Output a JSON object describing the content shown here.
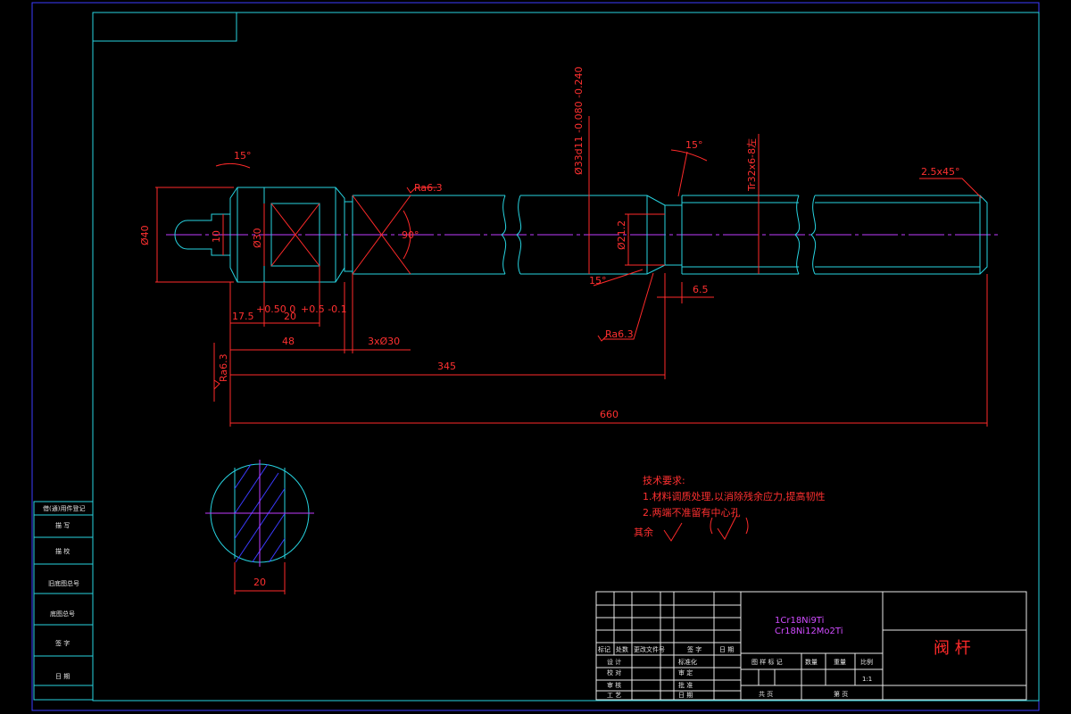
{
  "part_view": {
    "dims": {
      "d40": "Ø40",
      "d10": "10",
      "d30": "Ø30",
      "ang15_left": "15°",
      "ang90": "90°",
      "ang15_mid": "15°",
      "ang15_low": "15°",
      "d212": "Ø21.2",
      "d33": "Ø33d11 -0.080 -0.240",
      "thread": "Tr32x6-8左",
      "chamfer": "2.5x45°",
      "ra_top": "Ra6.3",
      "ra_low": "Ra6.3",
      "ra_left": "Ra6.3",
      "len175": "17.5",
      "tol175": "+0.50 0",
      "len20": "20",
      "tol20": "+0.5 -0.1",
      "len48": "48",
      "grooves": "3xØ30",
      "len65": "6.5",
      "len345": "345",
      "len660": "660"
    },
    "section_dim": "20"
  },
  "notes": {
    "title": "技术要求:",
    "line1": "1.材料调质处理,以消除残余应力,提高韧性",
    "line2": "2.两端不准留有中心孔",
    "rest_label": "其余"
  },
  "left_strip": {
    "items": [
      "借(通)用件登记",
      "描 写",
      "描 校",
      "旧底图总号",
      "底图总号",
      "签 字",
      "日 期"
    ]
  },
  "title_block": {
    "material_1": "1Cr18Ni9Ti",
    "material_2": "Cr18Ni12Mo2Ti",
    "part_name": "阀 杆",
    "header_row": [
      "标记",
      "处数",
      "更改文件号",
      "签 字",
      "日 期"
    ],
    "rows_left": [
      "设 计",
      "校 对",
      "审 核",
      "工 艺"
    ],
    "rows_mid": [
      "标准化",
      "审 定",
      "批 准",
      "日 期"
    ],
    "stage_row": [
      "图 样 标 记",
      "数量",
      "重量",
      "比例"
    ],
    "scale": "1:1",
    "sheets_total": "共 页",
    "sheet_no": "第 页"
  }
}
